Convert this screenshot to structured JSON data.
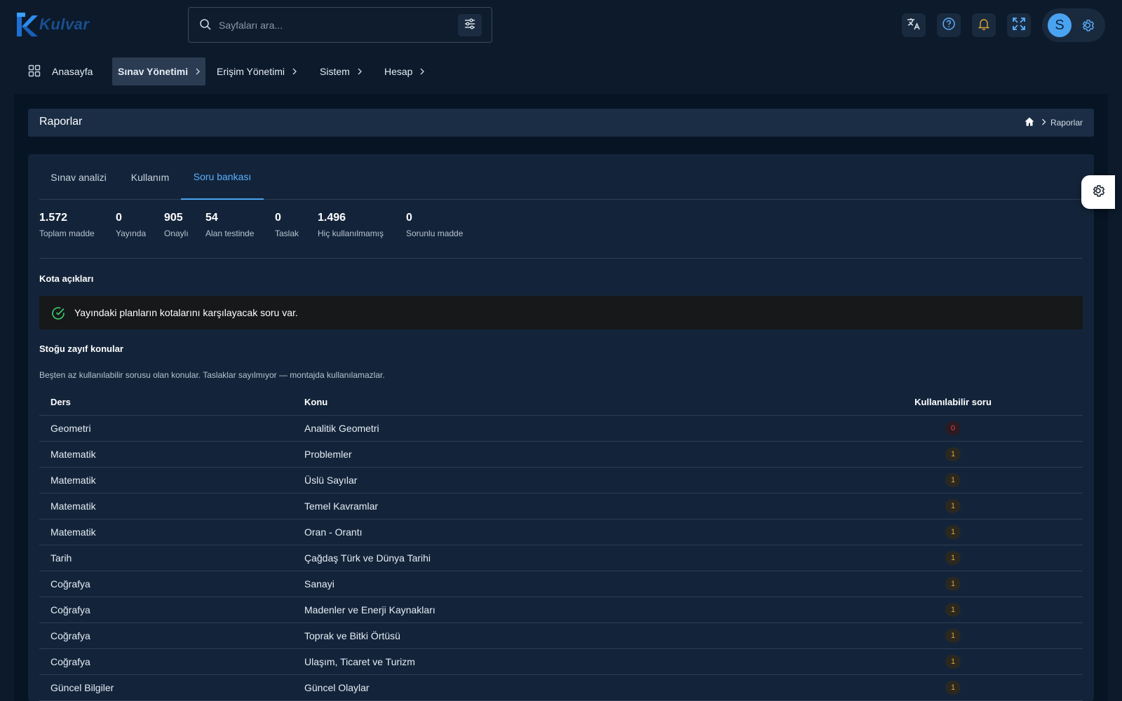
{
  "header": {
    "logo_text": "Kulvar",
    "search_placeholder": "Sayfaları ara...",
    "profile_initial": "S",
    "accent_color": "#4aa3f0"
  },
  "nav": {
    "items": [
      {
        "label": "Anasayfa"
      },
      {
        "label": "Sınav Yönetimi",
        "active": true
      },
      {
        "label": "Erişim Yönetimi"
      },
      {
        "label": "Sistem"
      },
      {
        "label": "Hesap"
      }
    ]
  },
  "page": {
    "title": "Raporlar",
    "breadcrumb_current": "Raporlar"
  },
  "tabs": [
    {
      "label": "Sınav analizi"
    },
    {
      "label": "Kullanım"
    },
    {
      "label": "Soru bankası",
      "active": true
    }
  ],
  "stats": [
    {
      "value": "1.572",
      "label": "Toplam madde"
    },
    {
      "value": "0",
      "label": "Yayında"
    },
    {
      "value": "905",
      "label": "Onaylı"
    },
    {
      "value": "54",
      "label": "Alan testinde"
    },
    {
      "value": "0",
      "label": "Taslak"
    },
    {
      "value": "1.496",
      "label": "Hiç kullanılmamış"
    },
    {
      "value": "0",
      "label": "Sorunlu madde"
    }
  ],
  "quota": {
    "title": "Kota açıkları",
    "message": "Yayındaki planların kotalarını karşılayacak soru var."
  },
  "weak_topics": {
    "title": "Stoğu zayıf konular",
    "description": "Beşten az kullanılabilir sorusu olan konular. Taslaklar sayılmıyor — montajda kullanılamazlar.",
    "columns": [
      "Ders",
      "Konu",
      "Kullanılabilir soru"
    ],
    "rows": [
      {
        "ders": "Geometri",
        "konu": "Analitik Geometri",
        "count": "0",
        "level": "red"
      },
      {
        "ders": "Matematik",
        "konu": "Problemler",
        "count": "1",
        "level": "amber"
      },
      {
        "ders": "Matematik",
        "konu": "Üslü Sayılar",
        "count": "1",
        "level": "amber"
      },
      {
        "ders": "Matematik",
        "konu": "Temel Kavramlar",
        "count": "1",
        "level": "amber"
      },
      {
        "ders": "Matematik",
        "konu": "Oran - Orantı",
        "count": "1",
        "level": "amber"
      },
      {
        "ders": "Tarih",
        "konu": "Çağdaş Türk ve Dünya Tarihi",
        "count": "1",
        "level": "amber"
      },
      {
        "ders": "Coğrafya",
        "konu": "Sanayi",
        "count": "1",
        "level": "amber"
      },
      {
        "ders": "Coğrafya",
        "konu": "Madenler ve Enerji Kaynakları",
        "count": "1",
        "level": "amber"
      },
      {
        "ders": "Coğrafya",
        "konu": "Toprak ve Bitki Örtüsü",
        "count": "1",
        "level": "amber"
      },
      {
        "ders": "Coğrafya",
        "konu": "Ulaşım, Ticaret ve Turizm",
        "count": "1",
        "level": "amber"
      },
      {
        "ders": "Güncel Bilgiler",
        "konu": "Güncel Olaylar",
        "count": "1",
        "level": "amber"
      }
    ]
  }
}
